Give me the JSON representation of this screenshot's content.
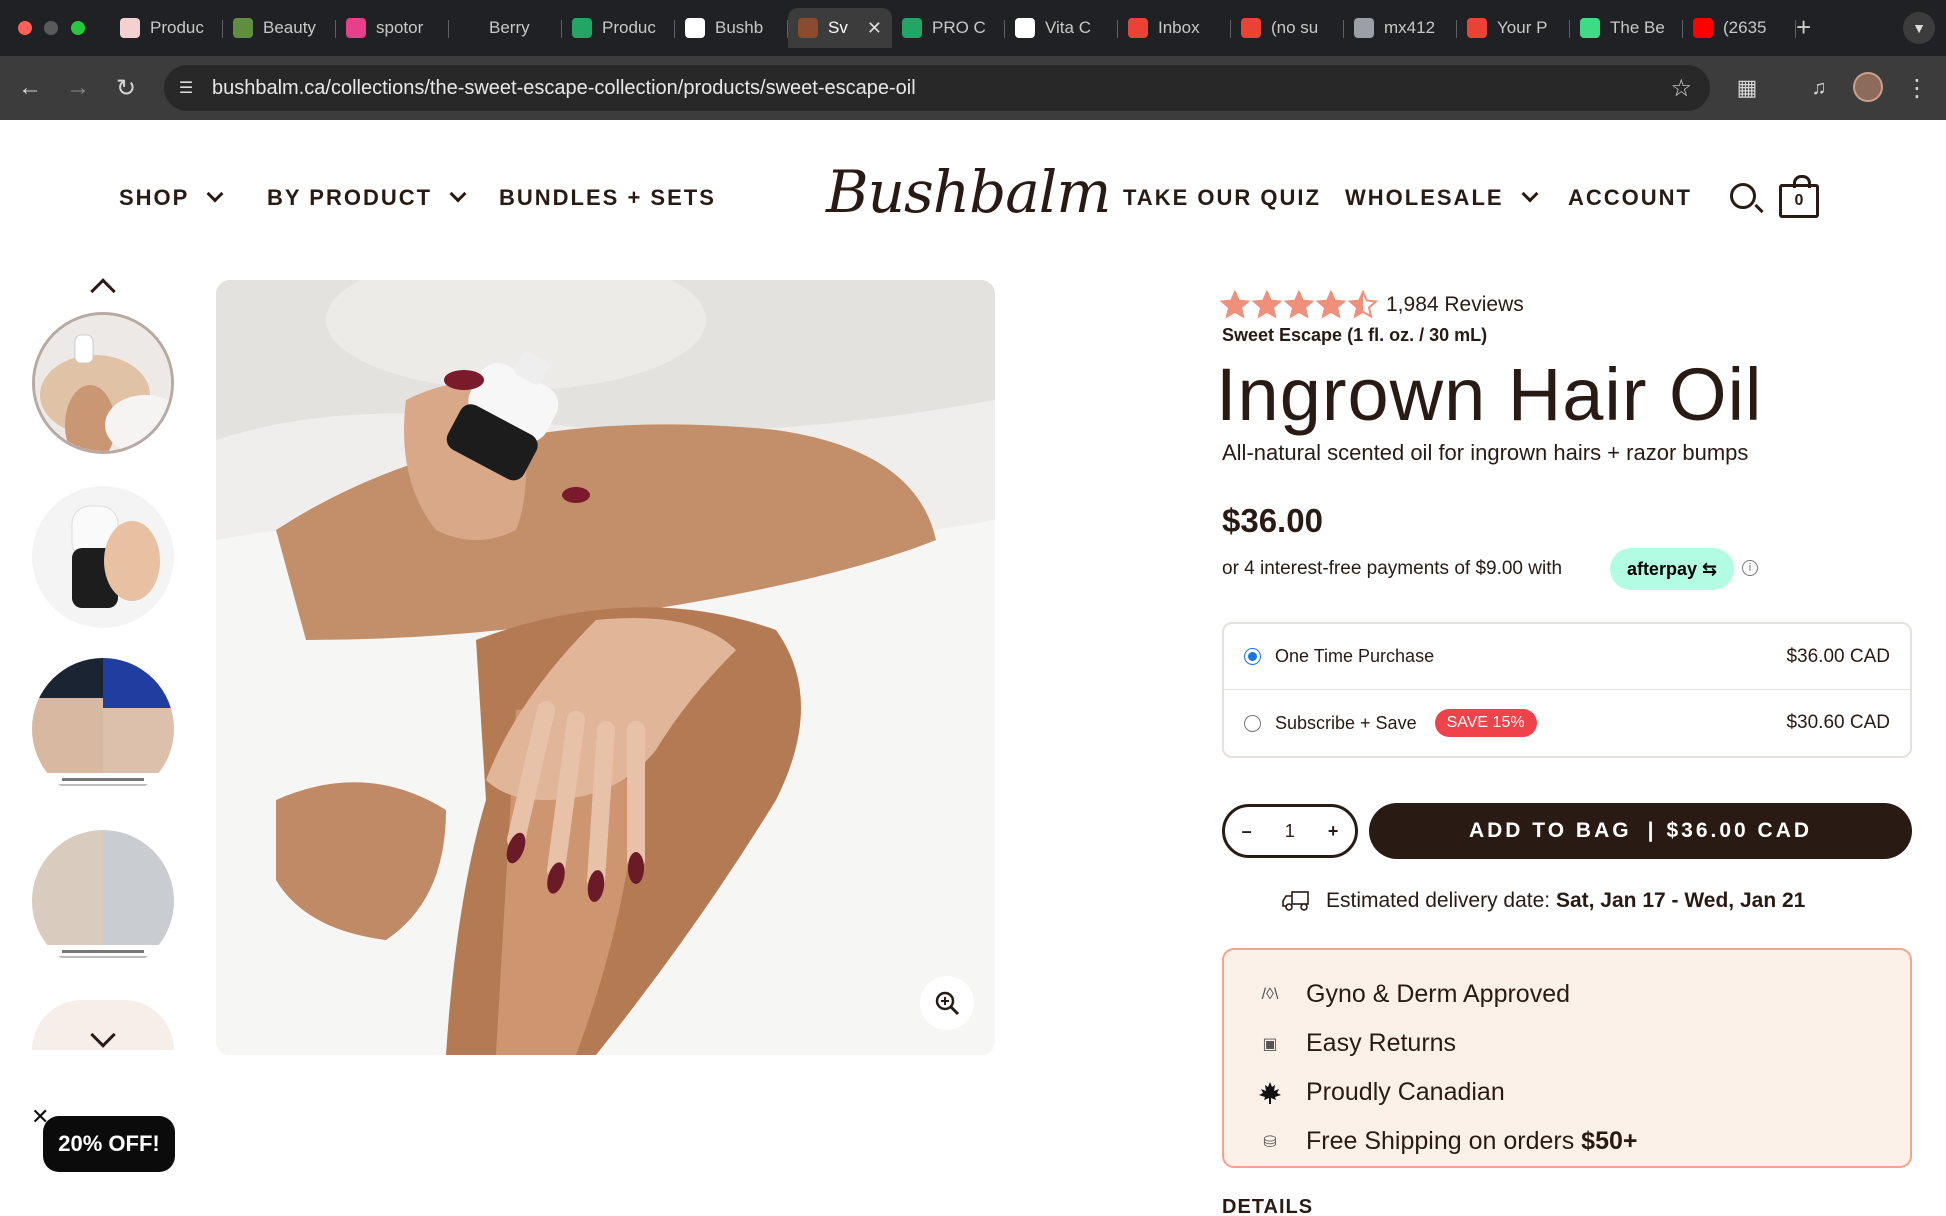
{
  "browser": {
    "tabs": [
      {
        "title": "Produc",
        "icon_color": "#f5d0d0"
      },
      {
        "title": "Beauty",
        "icon_color": "#5e8e3e"
      },
      {
        "title": "spotor",
        "icon_color": "#e83e8c"
      },
      {
        "title": "Berry",
        "icon_color": "#202124"
      },
      {
        "title": "Produc",
        "icon_color": "#23a566"
      },
      {
        "title": "Bushb",
        "icon_color": "#ffffff"
      },
      {
        "title": "Sv",
        "icon_color": "#8a4b2e",
        "active": true
      },
      {
        "title": "PRO C",
        "icon_color": "#23a566"
      },
      {
        "title": "Vita C",
        "icon_color": "#ffffff"
      },
      {
        "title": "Inbox",
        "icon_color": "#ea4335"
      },
      {
        "title": "(no su",
        "icon_color": "#ea4335"
      },
      {
        "title": "mx412",
        "icon_color": "#9aa0a6"
      },
      {
        "title": "Your P",
        "icon_color": "#ea4335"
      },
      {
        "title": "The Be",
        "icon_color": "#3ddc84"
      },
      {
        "title": "(2635",
        "icon_color": "#ff0000"
      }
    ],
    "url": "bushbalm.ca/collections/the-sweet-escape-collection/products/sweet-escape-oil"
  },
  "nav": {
    "shop": "SHOP",
    "by_product": "BY PRODUCT",
    "bundles": "BUNDLES + SETS",
    "logo": "Bushbalm",
    "quiz": "TAKE OUR QUIZ",
    "wholesale": "WHOLESALE",
    "account": "ACCOUNT",
    "cart_count": "0"
  },
  "product": {
    "rating": 4.5,
    "reviews": "1,984 Reviews",
    "variant": "Sweet Escape (1 fl. oz. / 30 mL)",
    "title": "Ingrown Hair Oil",
    "subtitle": "All-natural scented oil for ingrown hairs + razor bumps",
    "price": "$36.00",
    "installments": "or 4 interest-free payments of $9.00 with",
    "afterpay": "afterpay",
    "options": [
      {
        "label": "One Time Purchase",
        "price": "$36.00 CAD",
        "selected": true
      },
      {
        "label": "Subscribe + Save",
        "badge": "SAVE 15%",
        "price": "$30.60 CAD",
        "selected": false
      }
    ],
    "quantity": "1",
    "qty_minus": "–",
    "qty_plus": "+",
    "add_to_bag": "ADD TO BAG",
    "add_to_bag_price": "$36.00 CAD",
    "delivery_label": "Estimated delivery date:",
    "delivery_range": "Sat, Jan 17 - Wed, Jan 21",
    "perks": [
      {
        "icon": "gyno-icon",
        "text": "Gyno & Derm Approved"
      },
      {
        "icon": "returns-box-icon",
        "text": "Easy Returns"
      },
      {
        "icon": "maple-leaf-icon",
        "text": "Proudly Canadian"
      },
      {
        "icon": "shipping-truck-icon",
        "text": "Free Shipping on orders",
        "bold": "$50+"
      }
    ],
    "details": "DETAILS"
  },
  "promo": "20% OFF!",
  "colors": {
    "brand_dark": "#2a1a14",
    "star": "#f0907a",
    "save_badge": "#f0424a",
    "afterpay": "#b2fce4",
    "perks_bg": "#fcf1e8",
    "perks_border": "#f0a58c"
  }
}
